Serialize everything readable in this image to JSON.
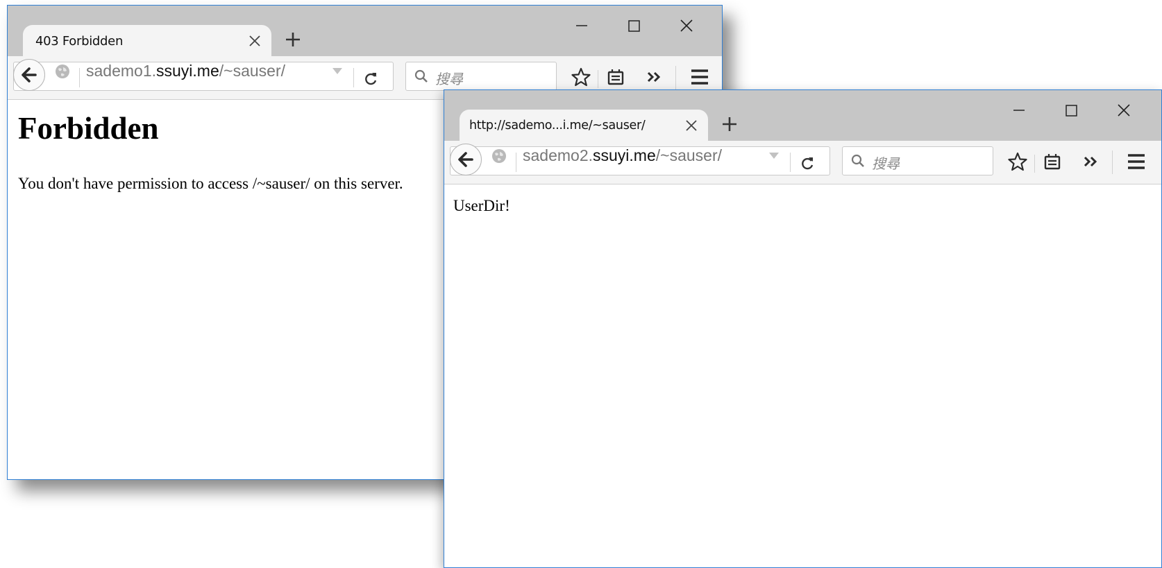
{
  "window1": {
    "tab_title": "403 Forbidden",
    "url_prefix": "sademo1.",
    "url_domain": "ssuyi.me",
    "url_path": "/~sauser/",
    "search_placeholder": "搜尋",
    "page_heading": "Forbidden",
    "page_message": "You don't have permission to access /~sauser/ on this server."
  },
  "window2": {
    "tab_title": "http://sademo...i.me/~sauser/",
    "url_prefix": "sademo2.",
    "url_domain": "ssuyi.me",
    "url_path": "/~sauser/",
    "search_placeholder": "搜尋",
    "page_text": "UserDir!"
  },
  "icons": [
    "back-arrow-icon",
    "globe-icon",
    "dropdown-arrow-icon",
    "reload-icon",
    "search-icon",
    "star-icon",
    "reading-list-icon",
    "overflow-chevron-icon",
    "hamburger-menu-icon",
    "close-icon",
    "plus-icon",
    "minimize-icon",
    "maximize-icon"
  ],
  "colors": {
    "titlebar": "#c6c6c6",
    "toolbar": "#f4f4f4",
    "window_border": "#2f7fd4"
  }
}
